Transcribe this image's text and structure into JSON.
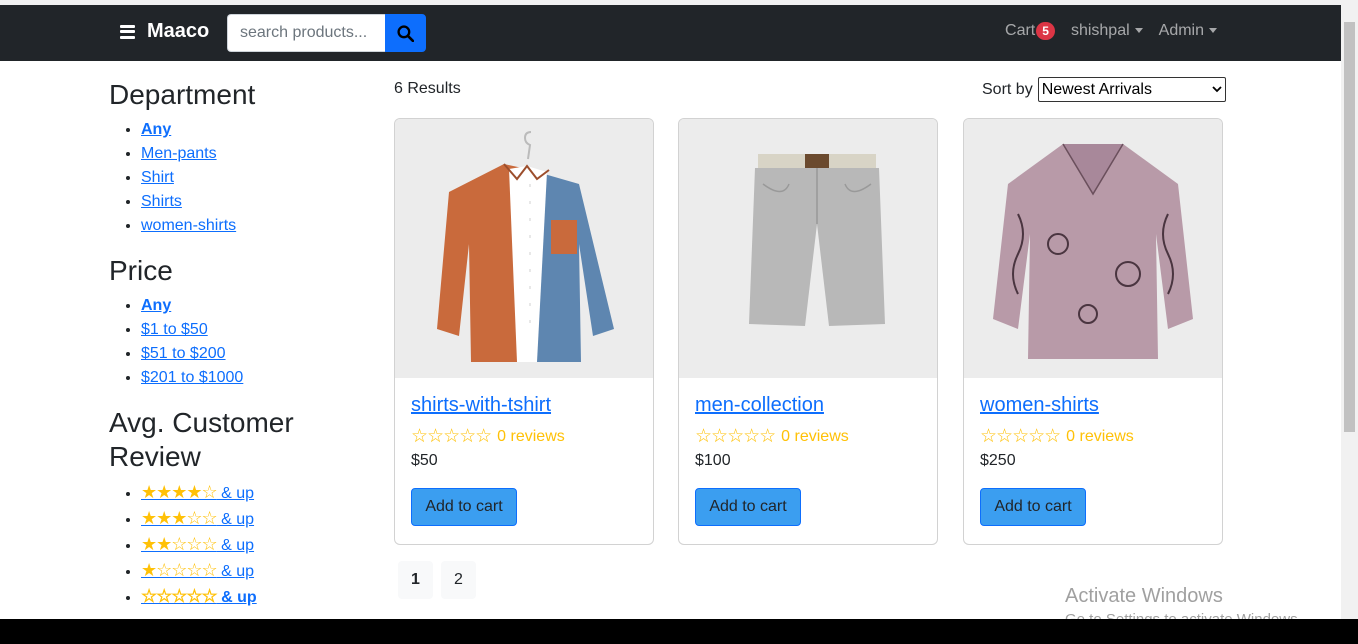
{
  "header": {
    "brand": "Maaco",
    "search_placeholder": "search products...",
    "cart_label": "Cart",
    "cart_count": "5",
    "user_menu": "shishpal",
    "admin_menu": "Admin"
  },
  "sidebar": {
    "department": {
      "title": "Department",
      "items": [
        "Any",
        "Men-pants",
        "Shirt",
        "Shirts",
        "women-shirts"
      ]
    },
    "price": {
      "title": "Price",
      "items": [
        "Any",
        "$1 to $50",
        "$51 to $200",
        "$201 to $1000"
      ]
    },
    "review": {
      "title": "Avg. Customer Review",
      "up_label": " & up",
      "ratings": [
        4,
        3,
        2,
        1,
        0
      ]
    }
  },
  "results": {
    "count_label": "6 Results",
    "sort_label": "Sort by",
    "sort_value": "Newest Arrivals"
  },
  "products": [
    {
      "name": "shirts-with-tshirt",
      "reviews": "0 reviews",
      "price": "$50",
      "button": "Add to cart"
    },
    {
      "name": "men-collection",
      "reviews": "0 reviews",
      "price": "$100",
      "button": "Add to cart"
    },
    {
      "name": "women-shirts",
      "reviews": "0 reviews",
      "price": "$250",
      "button": "Add to cart"
    }
  ],
  "pagination": {
    "pages": [
      "1",
      "2"
    ],
    "active": "1"
  },
  "watermark": {
    "line1": "Activate Windows",
    "line2": "Go to Settings to activate Windows."
  },
  "colors": {
    "navbar": "#212529",
    "link": "#0d6efd",
    "star": "#ffc107",
    "badge": "#dc3545",
    "button": "#3b9ef0"
  }
}
